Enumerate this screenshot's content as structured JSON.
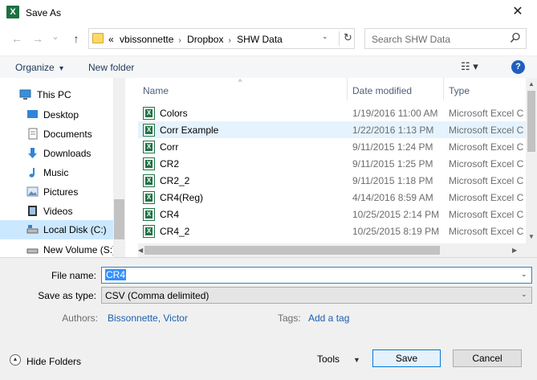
{
  "window": {
    "title": "Save As",
    "close_glyph": "✕",
    "app_icon": "excel-icon",
    "app_icon_letter": "X"
  },
  "nav": {
    "back_glyph": "←",
    "forward_glyph": "→",
    "recent_glyph": "⌄",
    "up_glyph": "↑"
  },
  "address": {
    "overflow": "«",
    "crumbs": [
      "vbissonnette",
      "Dropbox",
      "SHW Data"
    ],
    "dropdown_glyph": "⌄",
    "refresh_glyph": "↻"
  },
  "search": {
    "placeholder": "Search SHW Data"
  },
  "toolbar": {
    "organize_label": "Organize",
    "organize_arrow": "▾",
    "new_folder_label": "New folder",
    "view_glyph": "☷ ▾",
    "help_glyph": "?"
  },
  "navpane": {
    "items": [
      {
        "label": "This PC",
        "icon": "computer-icon"
      },
      {
        "label": "Desktop",
        "icon": "desktop-icon"
      },
      {
        "label": "Documents",
        "icon": "documents-icon"
      },
      {
        "label": "Downloads",
        "icon": "downloads-icon"
      },
      {
        "label": "Music",
        "icon": "music-icon"
      },
      {
        "label": "Pictures",
        "icon": "pictures-icon"
      },
      {
        "label": "Videos",
        "icon": "videos-icon"
      },
      {
        "label": "Local Disk (C:)",
        "icon": "drive-icon"
      },
      {
        "label": "New Volume (S:)",
        "icon": "drive-icon"
      }
    ]
  },
  "columns": {
    "name": "Name",
    "date": "Date modified",
    "type": "Type",
    "sort_glyph": "^"
  },
  "files": [
    {
      "name": "Colors",
      "date": "1/19/2016 11:00 AM",
      "type": "Microsoft Excel C"
    },
    {
      "name": "Corr Example",
      "date": "1/22/2016 1:13 PM",
      "type": "Microsoft Excel C"
    },
    {
      "name": "Corr",
      "date": "9/11/2015 1:24 PM",
      "type": "Microsoft Excel C"
    },
    {
      "name": "CR2",
      "date": "9/11/2015 1:25 PM",
      "type": "Microsoft Excel C"
    },
    {
      "name": "CR2_2",
      "date": "9/11/2015 1:18 PM",
      "type": "Microsoft Excel C"
    },
    {
      "name": "CR4(Reg)",
      "date": "4/14/2016 8:59 AM",
      "type": "Microsoft Excel C"
    },
    {
      "name": "CR4",
      "date": "10/25/2015 2:14 PM",
      "type": "Microsoft Excel C"
    },
    {
      "name": "CR4_2",
      "date": "10/25/2015 8:19 PM",
      "type": "Microsoft Excel C"
    }
  ],
  "form": {
    "file_name_label": "File name:",
    "file_name_value": "CR4",
    "save_as_type_label": "Save as type:",
    "save_as_type_value": "CSV (Comma delimited)",
    "dropdown_glyph": "⌄",
    "authors_label": "Authors:",
    "authors_value": "Bissonnette, Victor",
    "tags_label": "Tags:",
    "tags_value": "Add a tag"
  },
  "footer": {
    "hide_folders_label": "Hide Folders",
    "hide_folders_glyph": "▲",
    "tools_label": "Tools",
    "tools_arrow": "▼",
    "save_label": "Save",
    "cancel_label": "Cancel"
  },
  "scroll": {
    "up": "▲",
    "down": "▼",
    "left": "◀",
    "right": "▶"
  },
  "colors": {
    "accent": "#0078d7",
    "selection": "#cce8ff",
    "hover_row": "#e5f3ff",
    "excel_green": "#217346",
    "help_blue": "#1f5fbf",
    "link": "#1a5fb4"
  }
}
